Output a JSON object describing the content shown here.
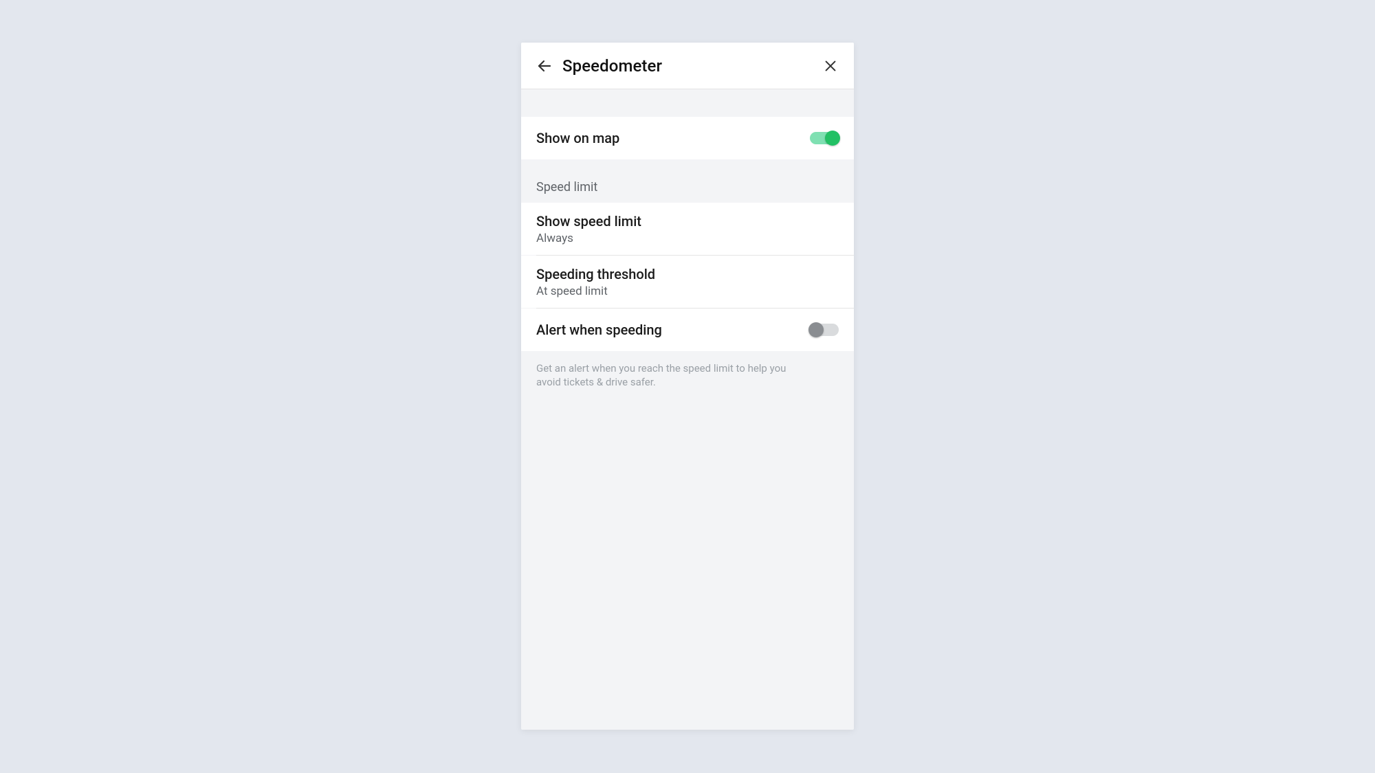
{
  "header": {
    "title": "Speedometer"
  },
  "show_on_map": {
    "label": "Show on map",
    "enabled": true
  },
  "section": {
    "speed_limit_header": "Speed limit"
  },
  "show_speed_limit": {
    "label": "Show speed limit",
    "value": "Always"
  },
  "speeding_threshold": {
    "label": "Speeding threshold",
    "value": "At speed limit"
  },
  "alert_when_speeding": {
    "label": "Alert when speeding",
    "enabled": false
  },
  "footer": {
    "text": "Get an alert when you reach the speed limit to help you avoid tickets & drive safer."
  }
}
